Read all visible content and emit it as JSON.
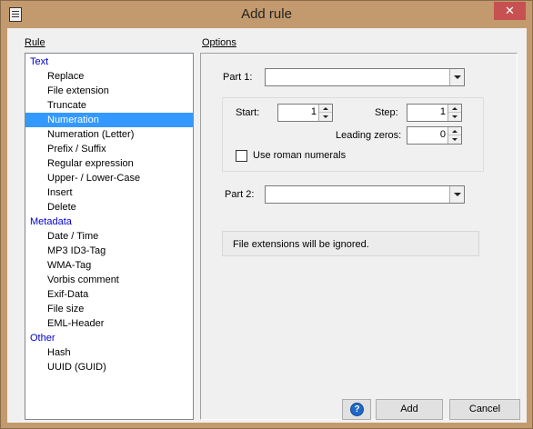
{
  "window": {
    "title": "Add rule",
    "close_glyph": "✕"
  },
  "rule_section": {
    "label": "Rule"
  },
  "options_section": {
    "label": "Options"
  },
  "rules": {
    "groups": [
      {
        "label": "Text",
        "items": [
          "Replace",
          "File extension",
          "Truncate",
          "Numeration",
          "Numeration (Letter)",
          "Prefix / Suffix",
          "Regular expression",
          "Upper- / Lower-Case",
          "Insert",
          "Delete"
        ]
      },
      {
        "label": "Metadata",
        "items": [
          "Date / Time",
          "MP3 ID3-Tag",
          "WMA-Tag",
          "Vorbis comment",
          "Exif-Data",
          "File size",
          "EML-Header"
        ]
      },
      {
        "label": "Other",
        "items": [
          "Hash",
          "UUID (GUID)"
        ]
      }
    ],
    "selected": "Numeration"
  },
  "options": {
    "part1_label": "Part 1:",
    "part1_value": "",
    "start_label": "Start:",
    "start_value": "1",
    "step_label": "Step:",
    "step_value": "1",
    "leading_zeros_label": "Leading zeros:",
    "leading_zeros_value": "0",
    "roman_label": "Use roman numerals",
    "roman_checked": false,
    "part2_label": "Part 2:",
    "part2_value": "",
    "info_text": "File extensions will be ignored."
  },
  "buttons": {
    "help_glyph": "?",
    "add": "Add",
    "cancel": "Cancel"
  },
  "colors": {
    "selection": "#3399ff",
    "group_text": "#0000d0",
    "frame": "#c39a6e",
    "close": "#c75050"
  }
}
